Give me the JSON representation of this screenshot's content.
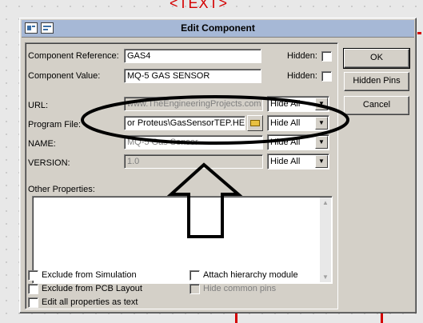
{
  "background": {
    "schematic_text": "<TEXT>"
  },
  "dialog": {
    "title": "Edit Component",
    "component_reference": {
      "label": "Component Reference:",
      "value": "GAS4",
      "hidden_label": "Hidden:"
    },
    "component_value": {
      "label": "Component Value:",
      "value": "MQ-5 GAS SENSOR",
      "hidden_label": "Hidden:"
    },
    "url": {
      "label": "URL:",
      "value": "www.TheEngineeringProjects.com",
      "select": "Hide All"
    },
    "program_file": {
      "label": "Program File:",
      "value": "or Proteus\\GasSensorTEP.HEX",
      "select": "Hide All"
    },
    "name": {
      "label": "NAME:",
      "value": "MQ-5 Gas Sensor",
      "select": "Hide All"
    },
    "version": {
      "label": "VERSION:",
      "value": "1.0",
      "select": "Hide All"
    },
    "other_properties": {
      "label": "Other Properties:"
    },
    "checkboxes": {
      "exclude_simulation": "Exclude from Simulation",
      "exclude_pcb": "Exclude from PCB Layout",
      "edit_all": "Edit all properties as text",
      "attach_hierarchy": "Attach hierarchy module",
      "hide_common_pins": "Hide common pins"
    },
    "buttons": {
      "ok": "OK",
      "hidden_pins": "Hidden Pins",
      "cancel": "Cancel"
    }
  },
  "colors": {
    "accent_red": "#d40000",
    "title_bar": "#a6b8d6",
    "dialog_bg": "#d4d0c8"
  }
}
